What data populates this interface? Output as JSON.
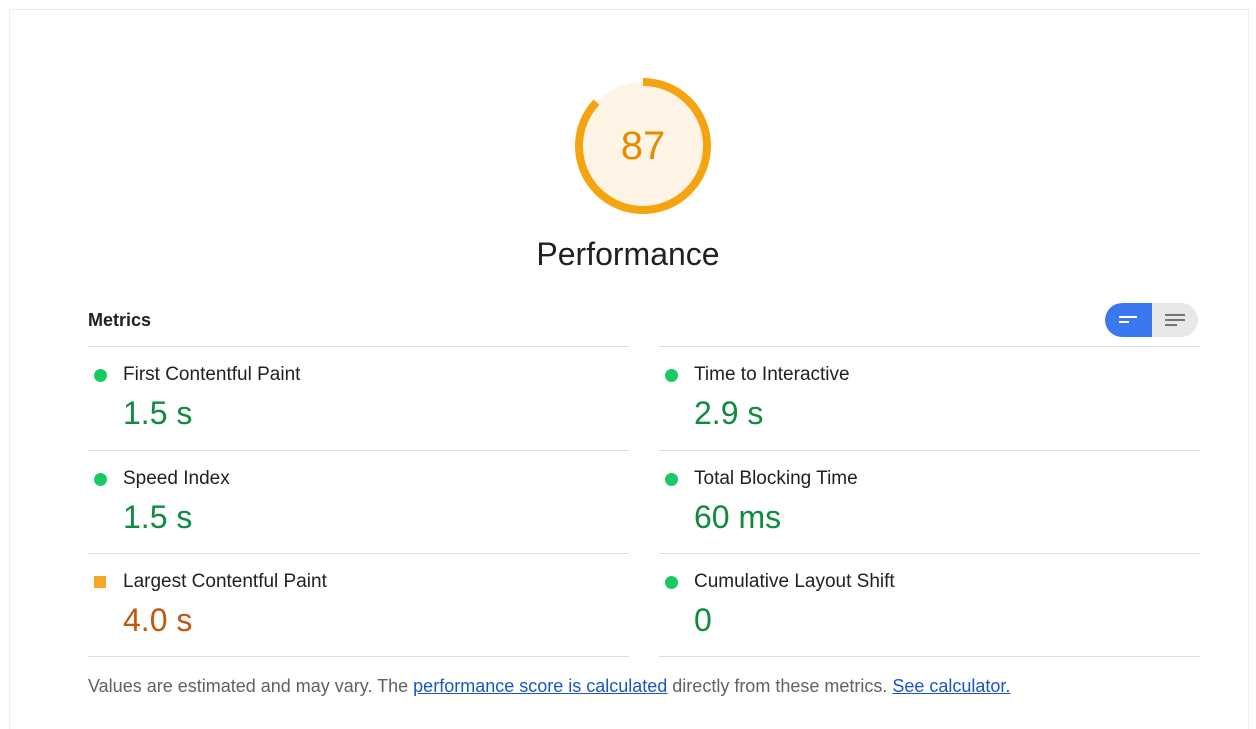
{
  "score_gauge": {
    "score": "87",
    "score_fraction": 0.87,
    "ring_color": "#f4a40f",
    "fill_color": "#fdf4e6",
    "text_color": "#e68a00"
  },
  "category": {
    "title": "Performance"
  },
  "metrics_section": {
    "heading": "Metrics",
    "toggle": {
      "left_icon": "condensed-view-icon",
      "right_icon": "expanded-view-icon",
      "active": "left"
    },
    "items": [
      {
        "label": "First Contentful Paint",
        "value": "1.5 s",
        "rating": "pass"
      },
      {
        "label": "Time to Interactive",
        "value": "2.9 s",
        "rating": "pass"
      },
      {
        "label": "Speed Index",
        "value": "1.5 s",
        "rating": "pass"
      },
      {
        "label": "Total Blocking Time",
        "value": "60 ms",
        "rating": "pass"
      },
      {
        "label": "Largest Contentful Paint",
        "value": "4.0 s",
        "rating": "average"
      },
      {
        "label": "Cumulative Layout Shift",
        "value": "0",
        "rating": "pass"
      }
    ]
  },
  "footnote": {
    "prefix": "Values are estimated and may vary. The ",
    "link1": "performance score is calculated",
    "middle": " directly from these metrics. ",
    "link2": "See calculator."
  },
  "colors": {
    "pass": "#18c964",
    "pass_text": "#108a3e",
    "average": "#f5a623",
    "average_text": "#c2570c",
    "toggle_active": "#3b77f0"
  }
}
